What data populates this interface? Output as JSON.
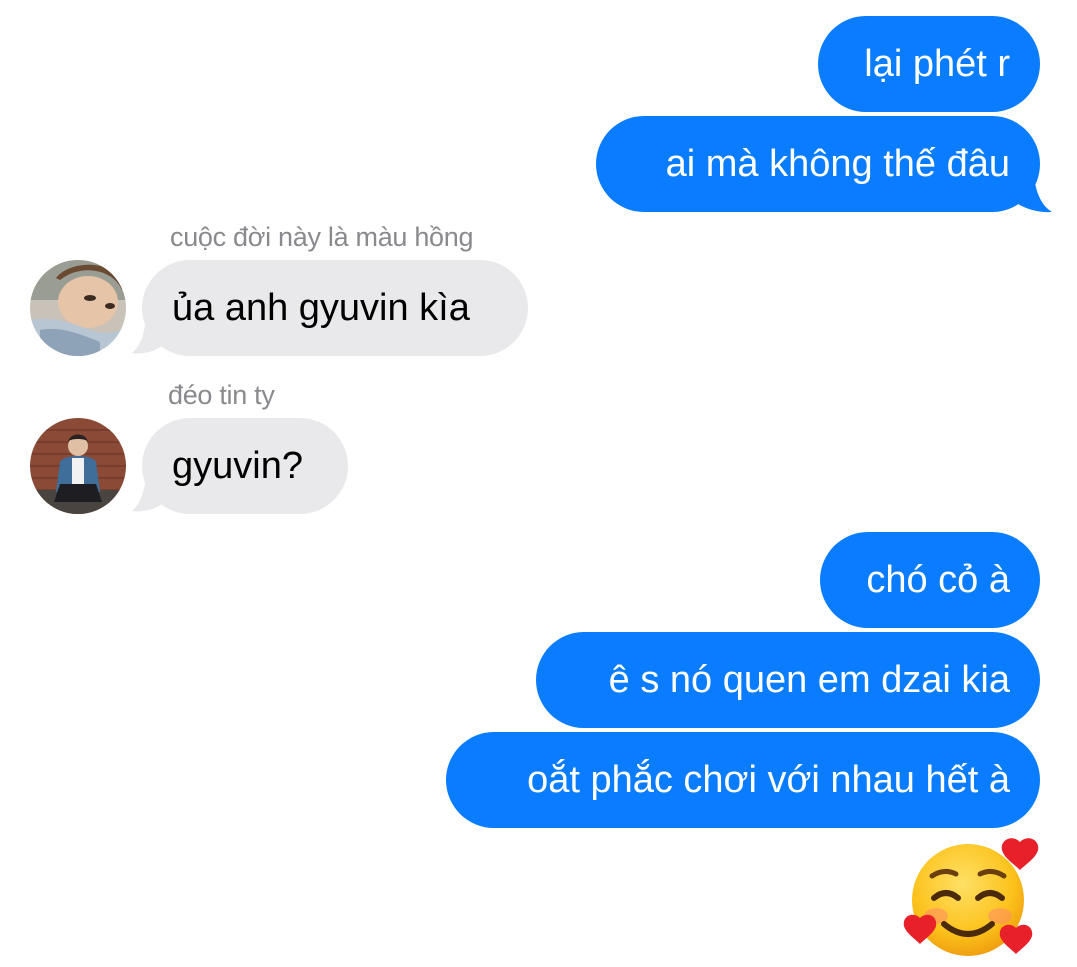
{
  "thread": {
    "colors": {
      "outgoing_bubble": "#0a7cff",
      "incoming_bubble": "#e9e9eb",
      "sender_name": "#8a8a8e"
    },
    "messages": [
      {
        "direction": "outgoing",
        "text": "lại phét r"
      },
      {
        "direction": "outgoing",
        "text": "ai mà không thế đâu"
      },
      {
        "direction": "incoming",
        "sender": "cuộc đời này là màu hồng",
        "avatar": "avatar-photo-person-lying-down",
        "text": "ủa anh gyuvin kìa"
      },
      {
        "direction": "incoming",
        "sender": "đéo tin ty",
        "avatar": "avatar-photo-person-sitting-brick-wall",
        "text": "gyuvin?"
      },
      {
        "direction": "outgoing",
        "text": "chó cỏ à"
      },
      {
        "direction": "outgoing",
        "text": "ê s nó quen em dzai kia"
      },
      {
        "direction": "outgoing",
        "text": "oắt phắc chơi với nhau hết à"
      },
      {
        "direction": "outgoing",
        "type": "emoji",
        "icon": "smiling-face-with-hearts-icon"
      }
    ]
  }
}
